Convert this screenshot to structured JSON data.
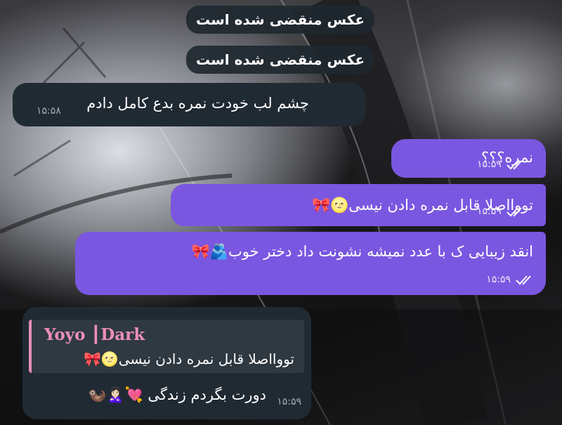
{
  "service_messages": [
    {
      "text": "عکس منقضی شده است"
    },
    {
      "text": "عکس منقضی شده است"
    }
  ],
  "messages": [
    {
      "direction": "incoming",
      "text": "چشم لب خودت نمره بدع کامل دادم",
      "time": "۱۵:۵۸"
    },
    {
      "direction": "outgoing",
      "text": "نمره؟؟؟",
      "time": "۱۵:۵۹",
      "status": "read"
    },
    {
      "direction": "outgoing",
      "text": "تووااصلا قابل نمره دادن نیسی🌝🎀",
      "time": "۱۵:۵۹",
      "status": "read"
    },
    {
      "direction": "outgoing",
      "text": "انقد زیبایی ک با عدد نمیشه نشونت داد دختر خوب🫂🎀",
      "time": "۱۵:۵۹",
      "status": "read"
    },
    {
      "direction": "incoming",
      "reply": {
        "name": "Yoyo ┃Dark",
        "text": "تووااصلا قابل نمره دادن نیسی🌝🎀"
      },
      "text": "دورت بگردم زندگی 💘🙎🏻‍♀️🦦",
      "time": "۱۵:۵۹"
    }
  ],
  "colors": {
    "outgoing_bubble": "#7a57e0",
    "incoming_bubble": "#202a33",
    "reply_accent": "#ec8fb7"
  }
}
